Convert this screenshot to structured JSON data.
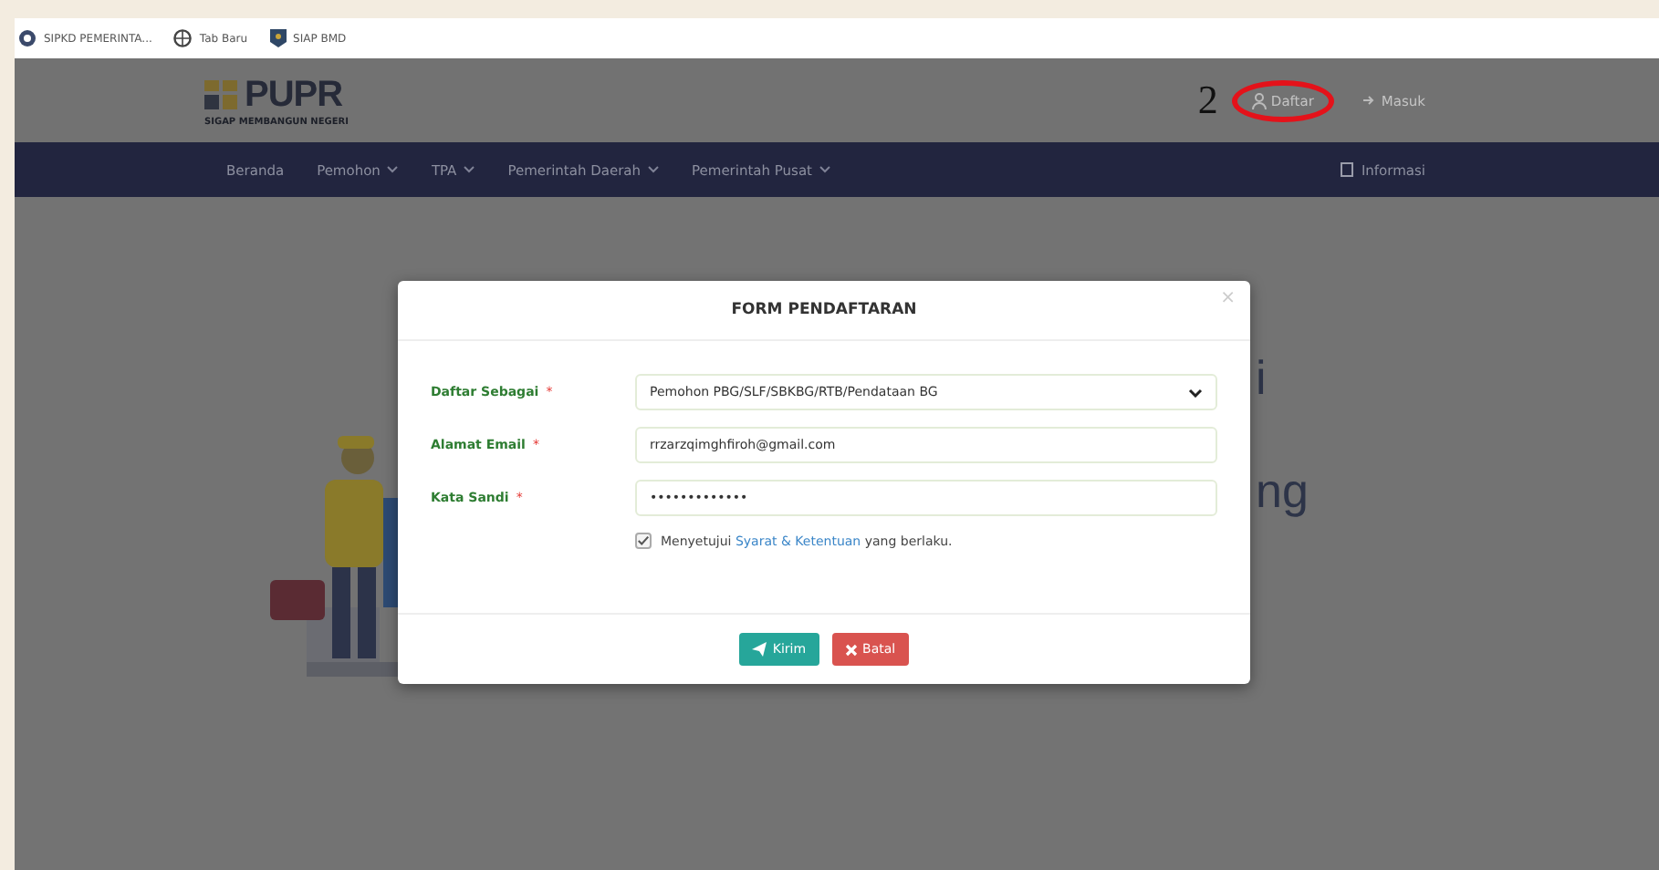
{
  "bookmarks": [
    {
      "label": "SIPKD PEMERINTA..."
    },
    {
      "label": "Tab Baru"
    },
    {
      "label": "SIAP BMD"
    }
  ],
  "header": {
    "logo_text": "PUPR",
    "logo_tagline": "SIGAP MEMBANGUN NEGERI",
    "annotation": "2",
    "links": [
      {
        "label": "Daftar",
        "circled": true
      },
      {
        "label": "Masuk",
        "circled": false
      }
    ]
  },
  "nav": {
    "items": [
      {
        "label": "Beranda",
        "dropdown": false
      },
      {
        "label": "Pemohon",
        "dropdown": true
      },
      {
        "label": "TPA",
        "dropdown": true
      },
      {
        "label": "Pemerintah Daerah",
        "dropdown": true
      },
      {
        "label": "Pemerintah Pusat",
        "dropdown": true
      }
    ],
    "info": "Informasi"
  },
  "hero_fragments": [
    "i",
    "ng"
  ],
  "modal": {
    "title": "FORM PENDAFTARAN",
    "close": "×",
    "fields": [
      {
        "label": "Daftar Sebagai",
        "required_mark": "*",
        "kind": "select",
        "value": "Pemohon PBG/SLF/SBKBG/RTB/Pendataan BG"
      },
      {
        "label": "Alamat Email",
        "required_mark": "*",
        "kind": "text",
        "value": "rrzarzqimghfiroh@gmail.com"
      },
      {
        "label": "Kata Sandi",
        "required_mark": "*",
        "kind": "text",
        "value": "•••••••••••••"
      }
    ],
    "agreement": {
      "checked": true,
      "before": "Menyetujui",
      "link": "Syarat & Ketentuan",
      "after": "yang berlaku."
    },
    "buttons": [
      {
        "label": "Kirim",
        "kind": "submit"
      },
      {
        "label": "Batal",
        "kind": "cancel"
      }
    ]
  }
}
